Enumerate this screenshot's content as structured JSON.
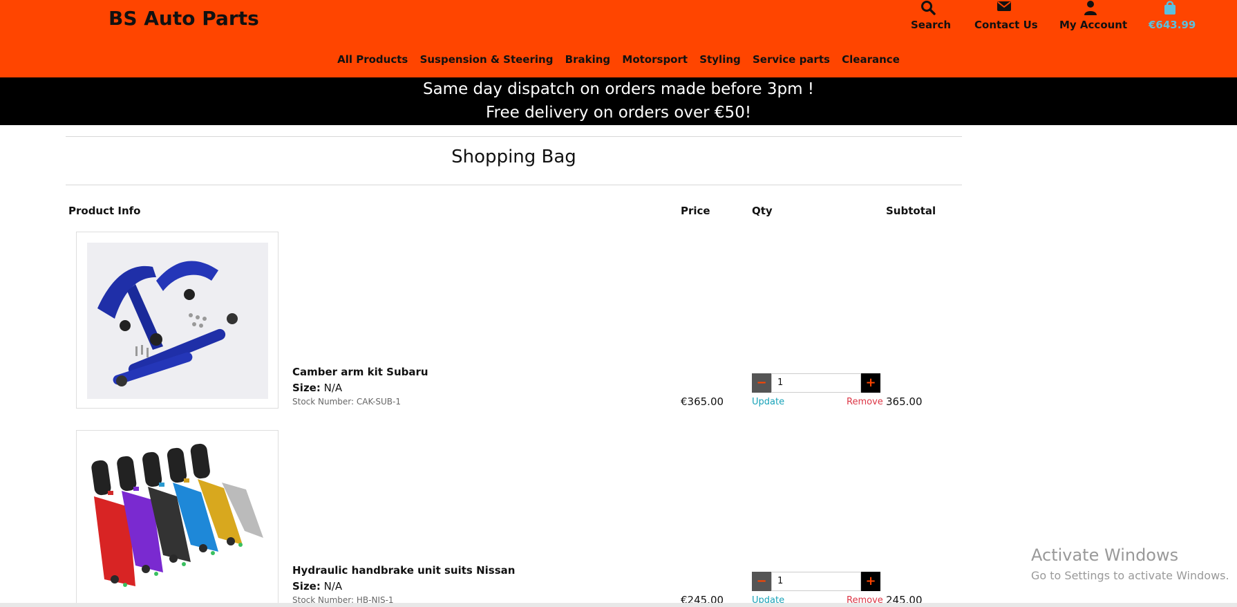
{
  "header": {
    "logo": "BS Auto Parts",
    "icons": {
      "search": "Search",
      "contact": "Contact Us",
      "account": "My Account",
      "bag_total": "€643.99"
    },
    "nav": [
      "All Products",
      "Suspension & Steering",
      "Braking",
      "Motorsport",
      "Styling",
      "Service parts",
      "Clearance"
    ]
  },
  "banner": {
    "line1": "Same day dispatch on orders made before 3pm !",
    "line2": "Free delivery on orders over €50!"
  },
  "page_title": "Shopping Bag",
  "table": {
    "headers": {
      "product": "Product Info",
      "price": "Price",
      "qty": "Qty",
      "subtotal": "Subtotal"
    },
    "size_label": "Size:",
    "update_label": "Update",
    "remove_label": "Remove",
    "items": [
      {
        "name": "Camber arm kit Subaru",
        "size": "N/A",
        "stock": "Stock Number: CAK-SUB-1",
        "price": "€365.00",
        "qty": "1",
        "subtotal": "365.00"
      },
      {
        "name": "Hydraulic handbrake unit suits Nissan",
        "size": "N/A",
        "stock": "Stock Number: HB-NIS-1",
        "price": "€245.00",
        "qty": "1",
        "subtotal": "245.00"
      }
    ]
  },
  "watermark": {
    "title": "Activate Windows",
    "subtitle": "Go to Settings to activate Windows."
  },
  "colors": {
    "brand_orange": "#ff4500",
    "banner_black": "#000000",
    "update_teal": "#17a2b8",
    "remove_red": "#dc3545"
  }
}
